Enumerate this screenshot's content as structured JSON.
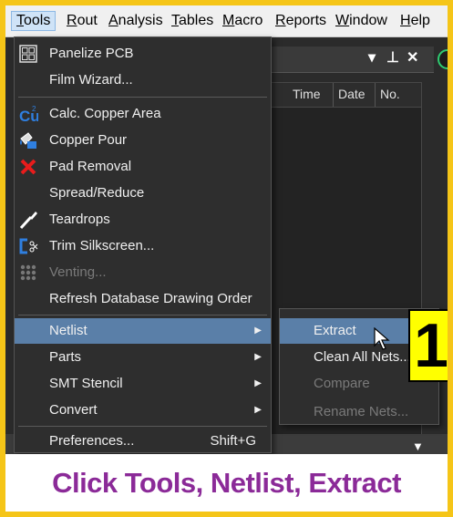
{
  "menubar": {
    "items": [
      "Tools",
      "Rout",
      "Analysis",
      "Tables",
      "Macro",
      "Reports",
      "Window",
      "Help"
    ],
    "active": "Tools"
  },
  "panel": {
    "columns": [
      "Time",
      "Date",
      "No."
    ],
    "controls": [
      "chevron-down-icon",
      "pin-icon",
      "close-icon"
    ]
  },
  "tools_menu": {
    "items": [
      {
        "label": "Panelize PCB",
        "icon": "panelize-icon"
      },
      {
        "label": "Film Wizard...",
        "icon": ""
      },
      {
        "label": "Calc. Copper Area",
        "icon": "copper-area-icon"
      },
      {
        "label": "Copper Pour",
        "icon": "copper-pour-icon"
      },
      {
        "label": "Pad Removal",
        "icon": "pad-removal-icon"
      },
      {
        "label": "Spread/Reduce",
        "icon": ""
      },
      {
        "label": "Teardrops",
        "icon": "teardrops-icon"
      },
      {
        "label": "Trim Silkscreen...",
        "icon": "trim-silkscreen-icon"
      },
      {
        "label": "Venting...",
        "icon": "venting-icon",
        "disabled": true
      },
      {
        "label": "Refresh Database Drawing Order",
        "icon": ""
      },
      {
        "label": "Netlist",
        "submenu": true,
        "highlighted": true
      },
      {
        "label": "Parts",
        "submenu": true
      },
      {
        "label": "SMT Stencil",
        "submenu": true
      },
      {
        "label": "Convert",
        "submenu": true
      },
      {
        "label": "Preferences...",
        "shortcut": "Shift+G"
      }
    ]
  },
  "netlist_submenu": {
    "items": [
      {
        "label": "Extract",
        "highlighted": true
      },
      {
        "label": "Clean All Nets..."
      },
      {
        "label": "Compare",
        "disabled": true
      },
      {
        "label": "Rename Nets...",
        "disabled": true
      }
    ]
  },
  "step_badge": "1",
  "caption": "Click Tools, Netlist, Extract",
  "colors": {
    "frame": "#f5c518",
    "caption_text": "#8b2a98",
    "highlight": "#5a7fa8",
    "badge": "#ffff00"
  }
}
